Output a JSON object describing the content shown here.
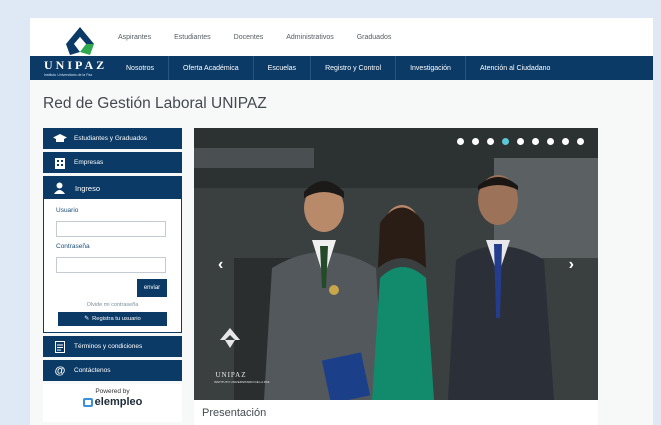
{
  "top_nav": [
    "Aspirantes",
    "Estudiantes",
    "Docentes",
    "Administrativos",
    "Graduados"
  ],
  "brand": {
    "name": "UNIPAZ",
    "subtitle": "Instituto Universitario de la Paz"
  },
  "main_nav": [
    "Nosotros",
    "Oferta Académica",
    "Escuelas",
    "Registro y Control",
    "Investigación",
    "Atención al Ciudadano"
  ],
  "page_title": "Red de Gestión Laboral UNIPAZ",
  "sidebar": {
    "students_label": "Estudiantes y Graduados",
    "companies_label": "Empresas",
    "login": {
      "title": "Ingreso",
      "user_label": "Usuario",
      "user_value": "",
      "password_label": "Contraseña",
      "password_value": "",
      "send_label": "enviar",
      "forgot_label": "Olvide mi contraseña",
      "register_label": "Registra tu usuario"
    },
    "terms_label": "Términos y condiciones",
    "contact_label": "Contáctenos",
    "powered_by": "Powered by",
    "powered_brand": "elempleo"
  },
  "slider": {
    "dot_count": 9,
    "active_index": 3,
    "watermark_name": "UNIPAZ",
    "watermark_sub": "INSTITUTO UNIVERSITARIO DE LA PAZ"
  },
  "section_title": "Presentación",
  "colors": {
    "navy": "#0b3a66",
    "accent": "#5bc8d6",
    "logo_green": "#2fa84f"
  }
}
